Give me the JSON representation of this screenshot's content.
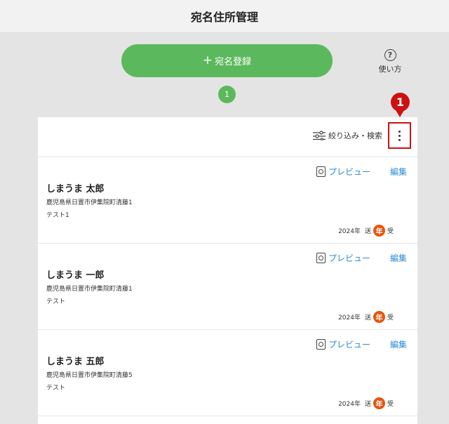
{
  "header": {
    "title": "宛名住所管理"
  },
  "register_button": {
    "icon": "plus-icon",
    "label": "宛名登録"
  },
  "help": {
    "icon_glyph": "?",
    "label": "使い方"
  },
  "pagination": {
    "current_page": "1"
  },
  "callout": {
    "number": "1",
    "color": "#cc1111"
  },
  "toolbar": {
    "filter_label": "絞り込み・検索",
    "more_icon": "more-vertical-icon"
  },
  "cards": [
    {
      "name": "しまうま 太郎",
      "address": "鹿児島県日置市伊集院町清藤1",
      "note": "テスト1",
      "year": "2024年",
      "sent": "送",
      "nen": "年",
      "received": "受",
      "preview_label": "プレビュー",
      "edit_label": "編集"
    },
    {
      "name": "しまうま 一郎",
      "address": "鹿児島県日置市伊集院町清藤1",
      "note": "テスト",
      "year": "2024年",
      "sent": "送",
      "nen": "年",
      "received": "受",
      "preview_label": "プレビュー",
      "edit_label": "編集"
    },
    {
      "name": "しまうま 五郎",
      "address": "鹿児島県日置市伊集院町清藤5",
      "note": "テスト",
      "year": "2024年",
      "sent": "送",
      "nen": "年",
      "received": "受",
      "preview_label": "プレビュー",
      "edit_label": "編集"
    }
  ],
  "colors": {
    "accent_green": "#5cb85c",
    "link_blue": "#2a8bd6",
    "nen_orange": "#e6550d",
    "highlight_red": "#cc1111"
  }
}
